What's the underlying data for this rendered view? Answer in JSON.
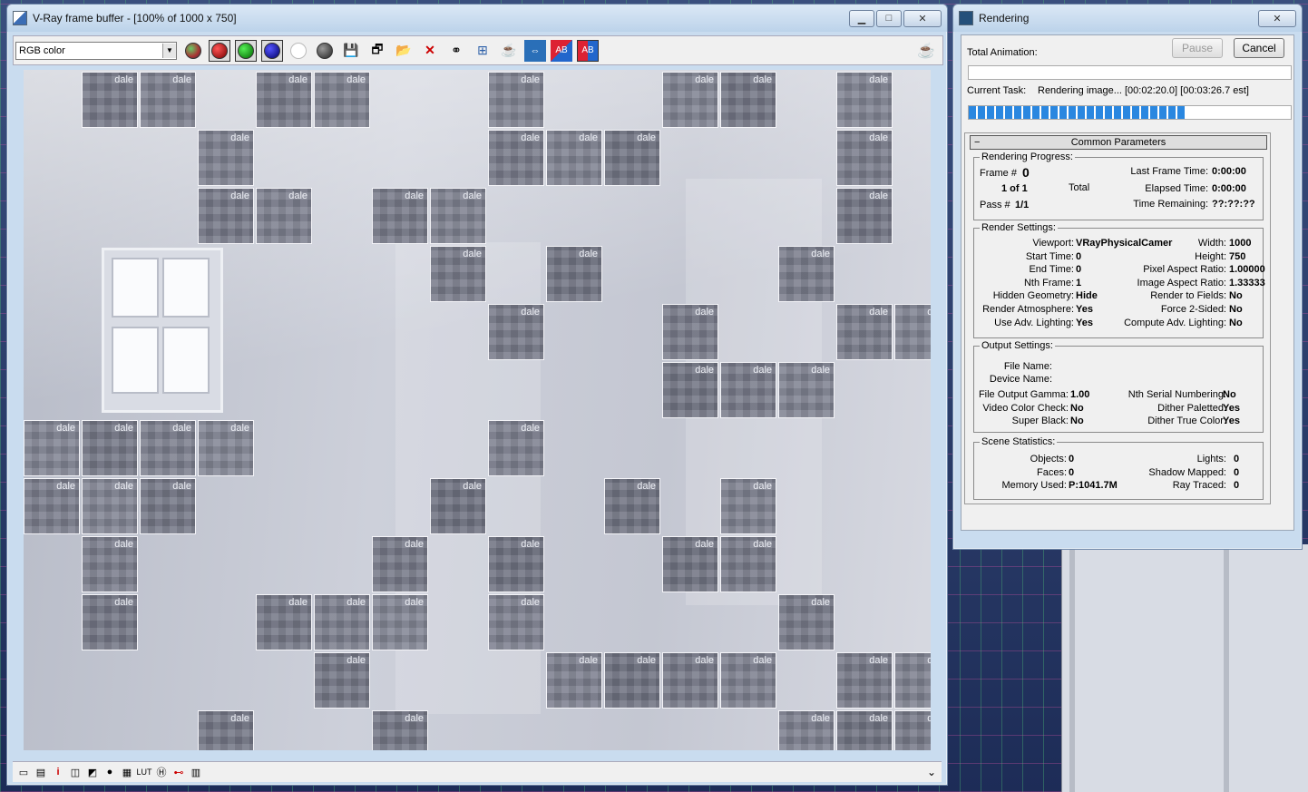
{
  "vfb": {
    "title": "V-Ray frame buffer - [100% of 1000 x 750]",
    "channel": "RGB color",
    "bucket_label": "dale",
    "buckets": [
      {
        "c": 1,
        "r": 0
      },
      {
        "c": 2,
        "r": 0
      },
      {
        "c": 4,
        "r": 0
      },
      {
        "c": 5,
        "r": 0
      },
      {
        "c": 8,
        "r": 0
      },
      {
        "c": 11,
        "r": 0
      },
      {
        "c": 12,
        "r": 0
      },
      {
        "c": 14,
        "r": 0
      },
      {
        "c": 3,
        "r": 1
      },
      {
        "c": 8,
        "r": 1
      },
      {
        "c": 9,
        "r": 1
      },
      {
        "c": 10,
        "r": 1
      },
      {
        "c": 14,
        "r": 1
      },
      {
        "c": 3,
        "r": 2
      },
      {
        "c": 4,
        "r": 2
      },
      {
        "c": 6,
        "r": 2
      },
      {
        "c": 7,
        "r": 2
      },
      {
        "c": 14,
        "r": 2
      },
      {
        "c": 7,
        "r": 3
      },
      {
        "c": 9,
        "r": 3
      },
      {
        "c": 13,
        "r": 3
      },
      {
        "c": 8,
        "r": 4
      },
      {
        "c": 11,
        "r": 4
      },
      {
        "c": 14,
        "r": 4
      },
      {
        "c": 15,
        "r": 4
      },
      {
        "c": 11,
        "r": 5
      },
      {
        "c": 12,
        "r": 5
      },
      {
        "c": 13,
        "r": 5
      },
      {
        "c": 0,
        "r": 6
      },
      {
        "c": 1,
        "r": 6
      },
      {
        "c": 2,
        "r": 6
      },
      {
        "c": 3,
        "r": 6
      },
      {
        "c": 8,
        "r": 6
      },
      {
        "c": 0,
        "r": 7
      },
      {
        "c": 1,
        "r": 7
      },
      {
        "c": 2,
        "r": 7
      },
      {
        "c": 7,
        "r": 7
      },
      {
        "c": 10,
        "r": 7
      },
      {
        "c": 12,
        "r": 7
      },
      {
        "c": 1,
        "r": 8
      },
      {
        "c": 6,
        "r": 8
      },
      {
        "c": 8,
        "r": 8
      },
      {
        "c": 11,
        "r": 8
      },
      {
        "c": 12,
        "r": 8
      },
      {
        "c": 1,
        "r": 9
      },
      {
        "c": 4,
        "r": 9
      },
      {
        "c": 5,
        "r": 9
      },
      {
        "c": 6,
        "r": 9
      },
      {
        "c": 8,
        "r": 9
      },
      {
        "c": 13,
        "r": 9
      },
      {
        "c": 5,
        "r": 10
      },
      {
        "c": 9,
        "r": 10
      },
      {
        "c": 10,
        "r": 10
      },
      {
        "c": 11,
        "r": 10
      },
      {
        "c": 12,
        "r": 10
      },
      {
        "c": 14,
        "r": 10
      },
      {
        "c": 15,
        "r": 10
      },
      {
        "c": 3,
        "r": 11
      },
      {
        "c": 6,
        "r": 11
      },
      {
        "c": 13,
        "r": 11
      },
      {
        "c": 14,
        "r": 11
      },
      {
        "c": 15,
        "r": 11
      }
    ],
    "toolbar_icons": [
      "sphere-icon",
      "red-channel-icon",
      "green-channel-icon",
      "blue-channel-icon",
      "alpha-channel-icon",
      "mono-icon",
      "save-icon",
      "save-all-icon",
      "load-icon",
      "clear-icon",
      "link-icon",
      "region-icon",
      "teapot-render-icon",
      "ab-compare-icon",
      "ab-horizontal-icon",
      "ab-vertical-icon"
    ],
    "status_icons": [
      "display-icon",
      "panel-icon",
      "info-icon",
      "levels-icon",
      "curve-icon",
      "color-icon",
      "srgb-icon",
      "lut-icon",
      "histogram-icon",
      "stamp-icon",
      "chart-icon"
    ]
  },
  "rendering": {
    "title": "Rendering",
    "pause": "Pause",
    "cancel": "Cancel",
    "total_animation": "Total Animation:",
    "current_task_label": "Current Task:",
    "current_task_value": "Rendering image... [00:02:20.0] [00:03:26.7 est]",
    "progress": 0.67,
    "common_parameters": "Common Parameters",
    "rendering_progress": {
      "title": "Rendering Progress:",
      "frame_label": "Frame #",
      "frame_value": "0",
      "of_value": "1 of 1",
      "total": "Total",
      "pass_label": "Pass #",
      "pass_value": "1/1",
      "last_frame_label": "Last Frame Time:",
      "last_frame_value": "0:00:00",
      "elapsed_label": "Elapsed Time:",
      "elapsed_value": "0:00:00",
      "remaining_label": "Time Remaining:",
      "remaining_value": "??:??:??"
    },
    "render_settings": {
      "title": "Render Settings:",
      "left": [
        {
          "k": "Viewport:",
          "v": "VRayPhysicalCamer"
        },
        {
          "k": "Start Time:",
          "v": "0"
        },
        {
          "k": "End Time:",
          "v": "0"
        },
        {
          "k": "Nth Frame:",
          "v": "1"
        },
        {
          "k": "Hidden Geometry:",
          "v": "Hide"
        },
        {
          "k": "Render Atmosphere:",
          "v": "Yes"
        },
        {
          "k": "Use Adv. Lighting:",
          "v": "Yes"
        }
      ],
      "right": [
        {
          "k": "Width:",
          "v": "1000"
        },
        {
          "k": "Height:",
          "v": "750"
        },
        {
          "k": "Pixel Aspect Ratio:",
          "v": "1.00000"
        },
        {
          "k": "Image Aspect Ratio:",
          "v": "1.33333"
        },
        {
          "k": "Render to Fields:",
          "v": "No"
        },
        {
          "k": "Force 2-Sided:",
          "v": "No"
        },
        {
          "k": "Compute Adv. Lighting:",
          "v": "No"
        }
      ]
    },
    "output_settings": {
      "title": "Output Settings:",
      "file_name": "File Name:",
      "device_name": "Device Name:",
      "left": [
        {
          "k": "File Output Gamma:",
          "v": "1.00"
        },
        {
          "k": "Video Color Check:",
          "v": "No"
        },
        {
          "k": "Super Black:",
          "v": "No"
        }
      ],
      "right": [
        {
          "k": "Nth Serial Numbering:",
          "v": "No"
        },
        {
          "k": "Dither Paletted:",
          "v": "Yes"
        },
        {
          "k": "Dither True Color:",
          "v": "Yes"
        }
      ]
    },
    "scene_statistics": {
      "title": "Scene Statistics:",
      "left": [
        {
          "k": "Objects:",
          "v": "0"
        },
        {
          "k": "Faces:",
          "v": "0"
        },
        {
          "k": "Memory Used:",
          "v": "P:1041.7M"
        }
      ],
      "right": [
        {
          "k": "Lights:",
          "v": "0"
        },
        {
          "k": "Shadow Mapped:",
          "v": "0"
        },
        {
          "k": "Ray Traced:",
          "v": "0"
        }
      ]
    }
  }
}
